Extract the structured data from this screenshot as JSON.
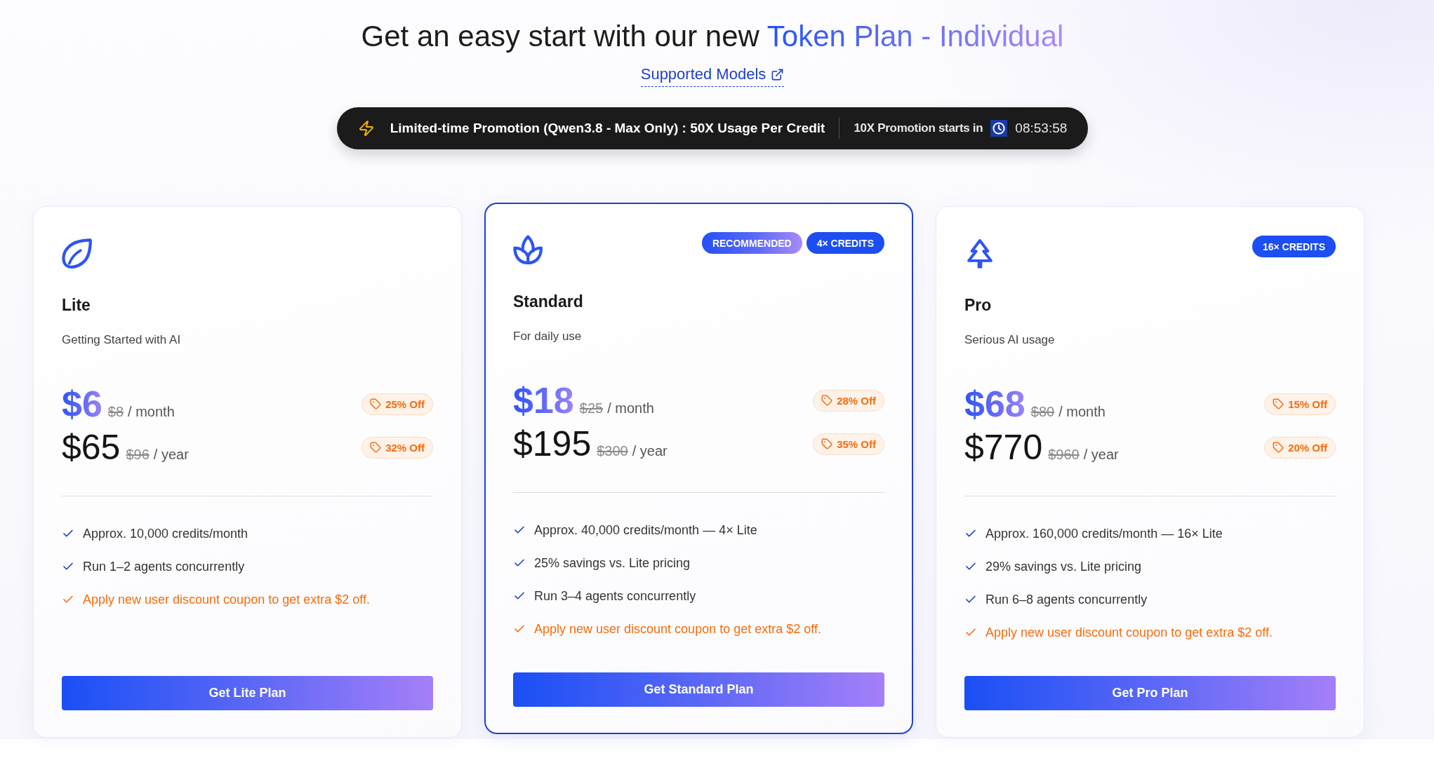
{
  "header": {
    "title": "Get an easy start with our new",
    "title_highlight": "Token Plan - Individual",
    "link": "Supported Models"
  },
  "promo_bar": {
    "message": "Limited-time Promotion (Qwen3.8 - Max Only) : 50X Usage Per Credit",
    "countdown_label": "10X Promotion starts in",
    "countdown": "08:53:58"
  },
  "plans": [
    {
      "kind": "lite",
      "name": "Lite",
      "subtitle": "Getting Started with AI",
      "featured": false,
      "prices": [
        {
          "kind": "month",
          "amount": "$6",
          "original": "$8",
          "period": "/ month",
          "discount": "25% Off"
        },
        {
          "kind": "year",
          "amount": "$65",
          "original": "$96",
          "period": "/ year",
          "discount": "32% Off"
        }
      ],
      "features": [
        {
          "text": "Approx. 10,000 credits/month",
          "highlighted": false
        },
        {
          "text": "Run 1–2 agents concurrently",
          "highlighted": false
        },
        {
          "text": "Apply new user discount coupon to get extra $2 off.",
          "highlighted": true
        }
      ],
      "button": "Get Lite Plan"
    },
    {
      "kind": "standard",
      "name": "Standard",
      "subtitle": "For daily use",
      "featured": true,
      "badges": [
        {
          "kind": "recommended",
          "text": "RECOMMENDED"
        },
        {
          "kind": "credits",
          "text": "4× CREDITS"
        }
      ],
      "prices": [
        {
          "kind": "month",
          "amount": "$18",
          "original": "$25",
          "period": "/ month",
          "discount": "28% Off"
        },
        {
          "kind": "year",
          "amount": "$195",
          "original": "$300",
          "period": "/ year",
          "discount": "35% Off"
        }
      ],
      "features": [
        {
          "text": "Approx. 40,000 credits/month — 4× Lite",
          "highlighted": false
        },
        {
          "text": "25% savings vs. Lite pricing",
          "highlighted": false
        },
        {
          "text": "Run 3–4 agents concurrently",
          "highlighted": false
        },
        {
          "text": "Apply new user discount coupon to get extra $2 off.",
          "highlighted": true
        }
      ],
      "button": "Get Standard Plan"
    },
    {
      "kind": "pro",
      "name": "Pro",
      "subtitle": "Serious AI usage",
      "featured": false,
      "badges": [
        {
          "kind": "credits",
          "text": "16× CREDITS"
        }
      ],
      "prices": [
        {
          "kind": "month",
          "amount": "$68",
          "original": "$80",
          "period": "/ month",
          "discount": "15% Off"
        },
        {
          "kind": "year",
          "amount": "$770",
          "original": "$960",
          "period": "/ year",
          "discount": "20% Off"
        }
      ],
      "features": [
        {
          "text": "Approx. 160,000 credits/month — 16× Lite",
          "highlighted": false
        },
        {
          "text": "29% savings vs. Lite pricing",
          "highlighted": false
        },
        {
          "text": "Run 6–8 agents concurrently",
          "highlighted": false
        },
        {
          "text": "Apply new user discount coupon to get extra $2 off.",
          "highlighted": true
        }
      ],
      "button": "Get Pro Plan"
    }
  ]
}
